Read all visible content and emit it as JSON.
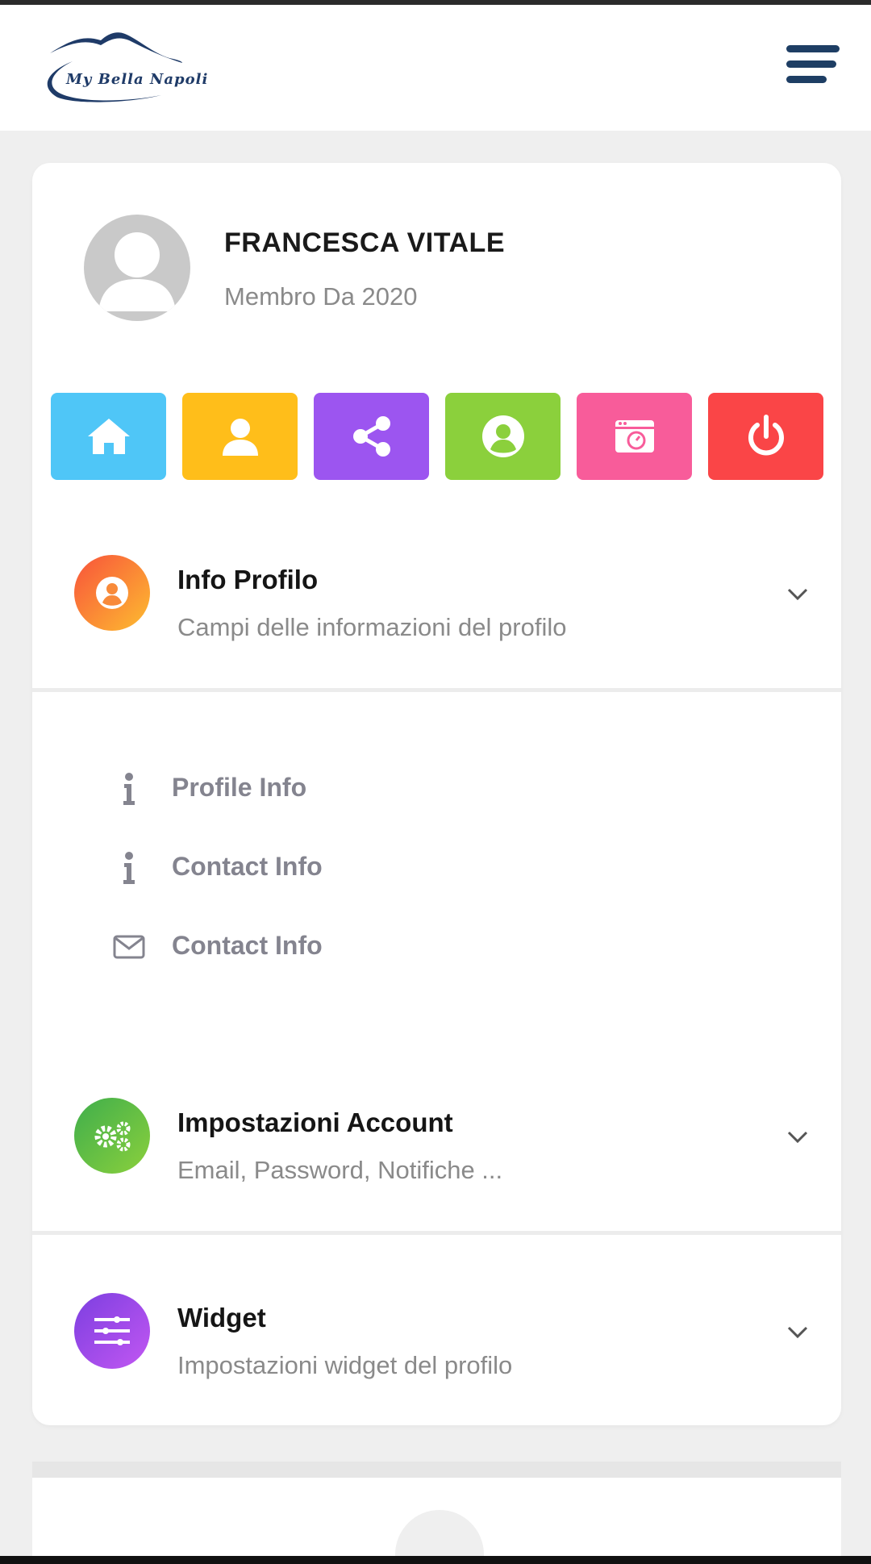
{
  "header": {
    "logo_text": "My Bella Napoli",
    "menu_icon": "hamburger-icon"
  },
  "profile": {
    "name": "FRANCESCA VITALE",
    "member_since": "Membro Da 2020",
    "avatar_icon": "user-avatar-placeholder"
  },
  "quick_actions": [
    {
      "icon": "home-icon",
      "color": "#4fc6f7"
    },
    {
      "icon": "user-icon",
      "color": "#ffbe1a"
    },
    {
      "icon": "share-icon",
      "color": "#9c55f0"
    },
    {
      "icon": "user-circle-icon",
      "color": "#8bd03c"
    },
    {
      "icon": "camera-icon",
      "color": "#f85c9a"
    },
    {
      "icon": "power-icon",
      "color": "#fa4547"
    }
  ],
  "sections": {
    "info_profilo": {
      "title": "Info Profilo",
      "subtitle": "Campi delle informazioni del profilo",
      "icon": "user-circle-icon",
      "items": [
        {
          "label": "Profile Info",
          "icon": "info-icon"
        },
        {
          "label": "Contact Info",
          "icon": "info-icon"
        },
        {
          "label": "Contact Info",
          "icon": "envelope-icon"
        }
      ]
    },
    "account": {
      "title": "Impostazioni Account",
      "subtitle": "Email, Password, Notifiche ...",
      "icon": "gears-icon"
    },
    "widget": {
      "title": "Widget",
      "subtitle": "Impostazioni widget del profilo",
      "icon": "sliders-icon"
    }
  }
}
